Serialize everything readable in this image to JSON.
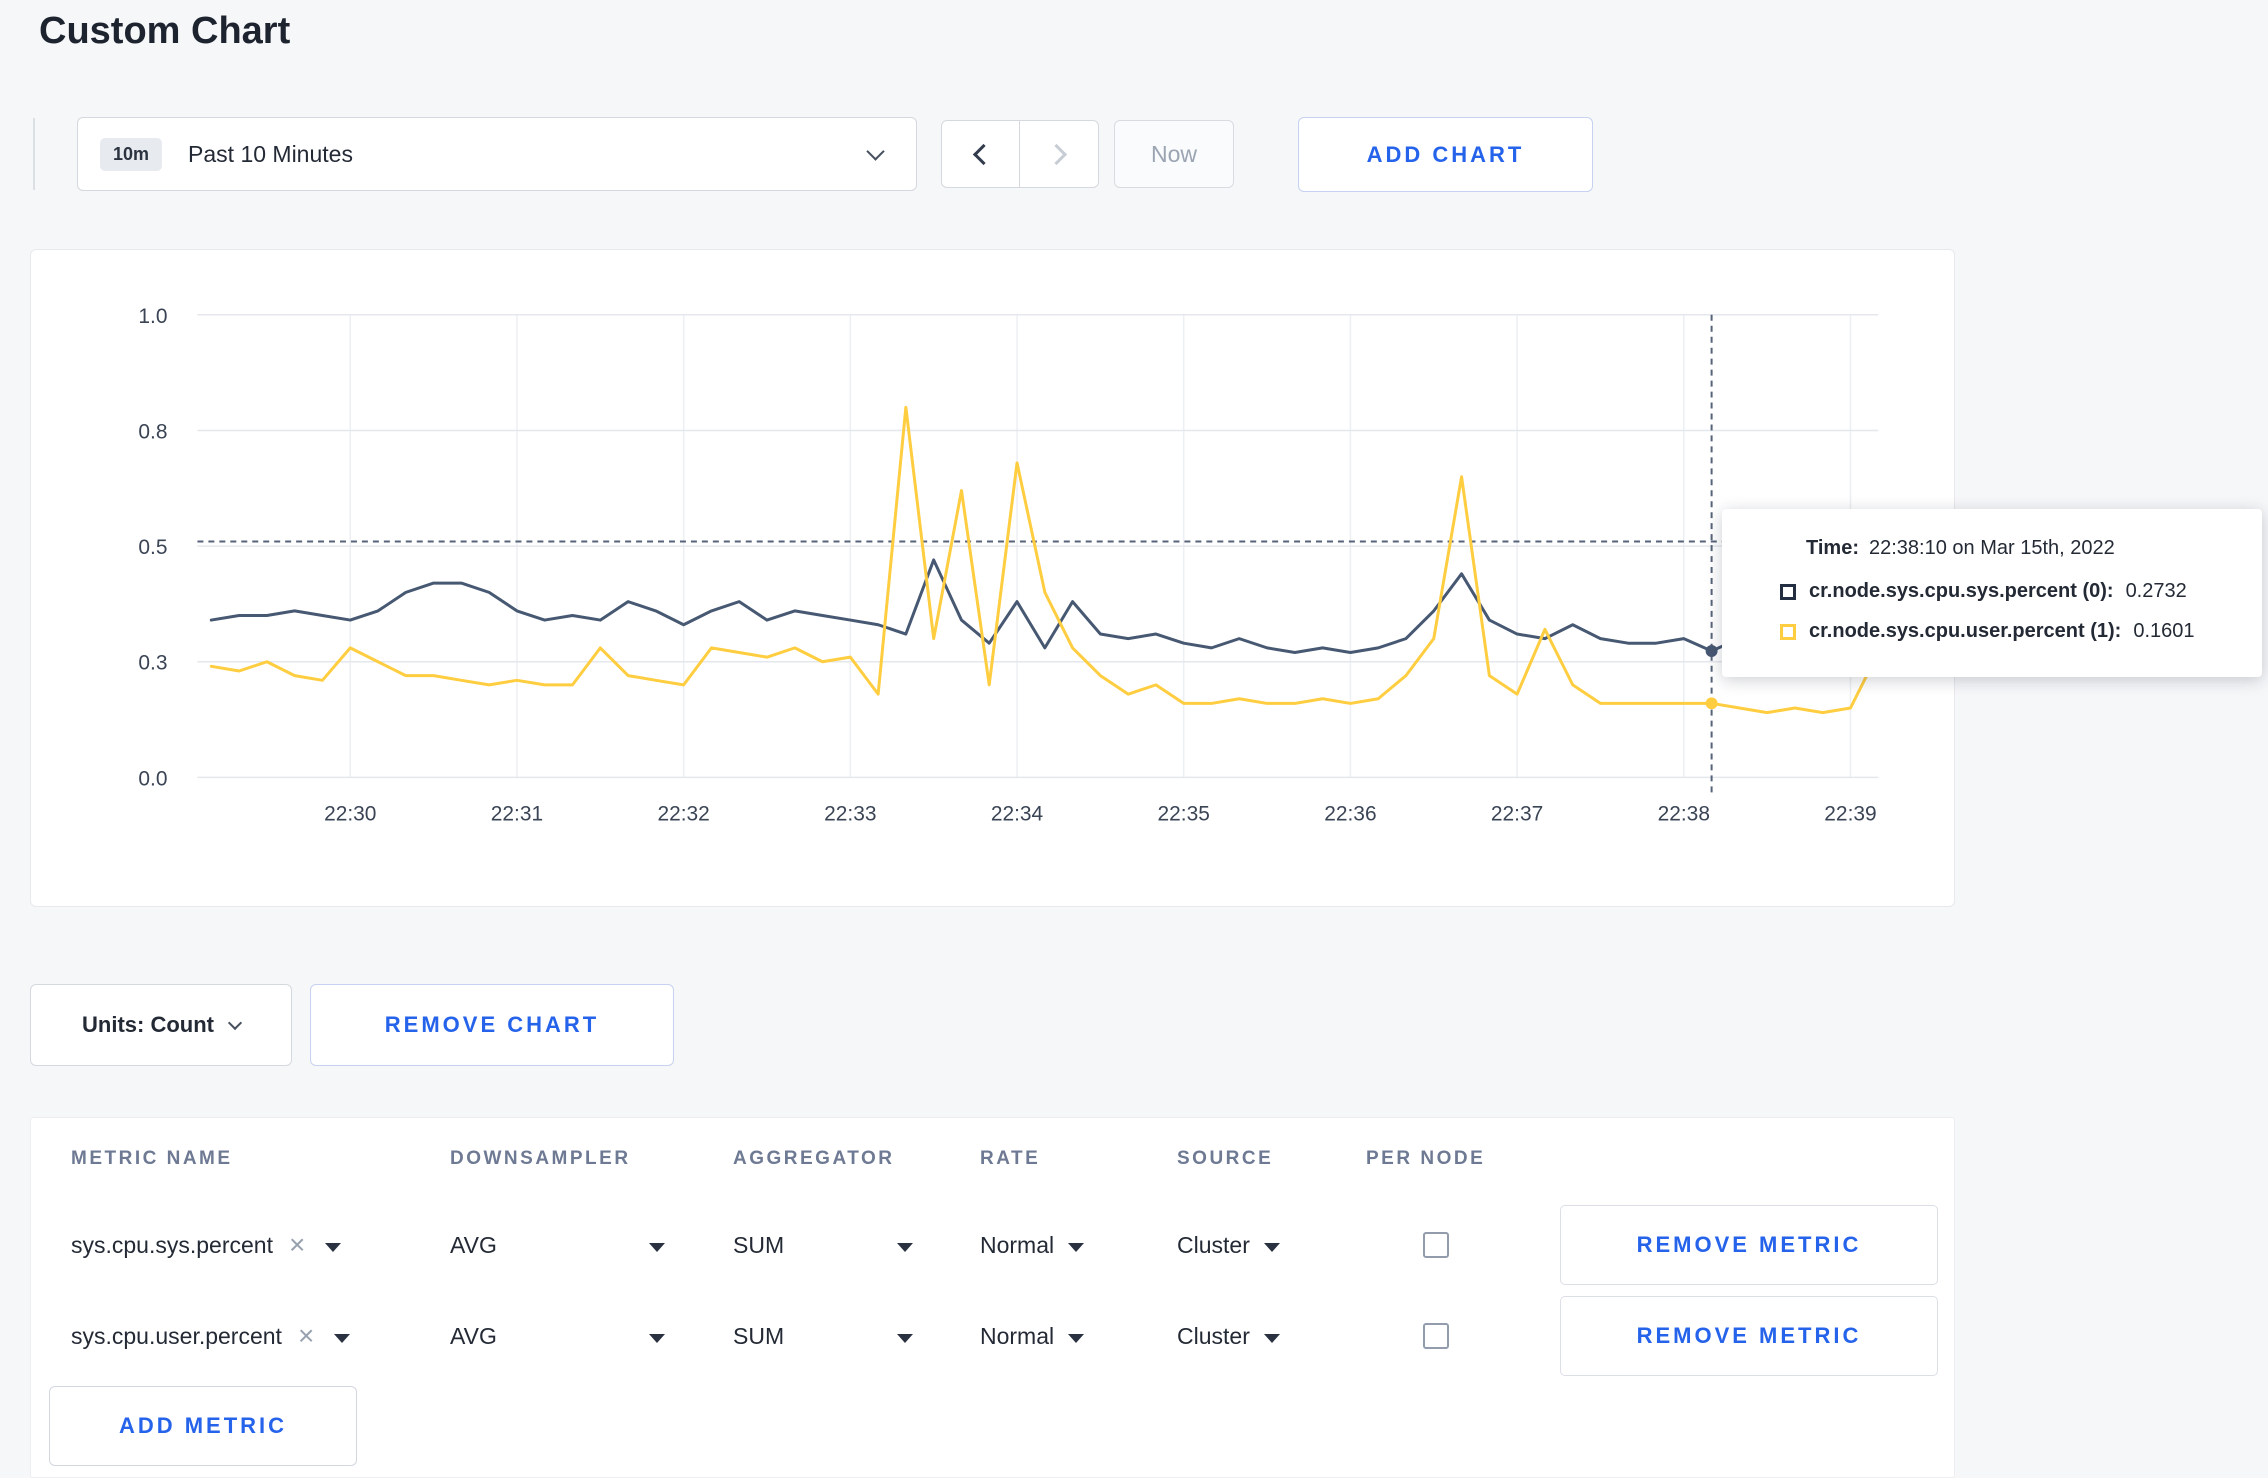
{
  "page": {
    "title": "Custom Chart",
    "background": "#f6f7f9",
    "accent": "#2563eb"
  },
  "toolbar": {
    "time_badge": "10m",
    "time_label": "Past 10 Minutes",
    "now_label": "Now",
    "add_chart_label": "ADD CHART"
  },
  "chart_data": {
    "type": "line",
    "title": "",
    "xlabel": "",
    "ylabel": "",
    "ylim": [
      0,
      1
    ],
    "grid": true,
    "x_ticks": [
      "22:30",
      "22:31",
      "22:32",
      "22:33",
      "22:34",
      "22:35",
      "22:36",
      "22:37",
      "22:38",
      "22:39"
    ],
    "y_ticks": [
      {
        "label": "0.0",
        "value": 0
      },
      {
        "label": "0.3",
        "value": 0.25
      },
      {
        "label": "0.5",
        "value": 0.5
      },
      {
        "label": "0.8",
        "value": 0.75
      },
      {
        "label": "1.0",
        "value": 1.0
      }
    ],
    "x_domain_sec": [
      -55,
      550
    ],
    "sample_start_sec": -50,
    "sample_step_sec": 10,
    "hline": 0.51,
    "crosshair_sec": 490,
    "series": [
      {
        "name": "cr.node.sys.cpu.sys.percent",
        "color": "#475872",
        "values": [
          0.34,
          0.35,
          0.35,
          0.36,
          0.35,
          0.34,
          0.36,
          0.4,
          0.42,
          0.42,
          0.4,
          0.36,
          0.34,
          0.35,
          0.34,
          0.38,
          0.36,
          0.33,
          0.36,
          0.38,
          0.34,
          0.36,
          0.35,
          0.34,
          0.33,
          0.31,
          0.47,
          0.34,
          0.29,
          0.38,
          0.28,
          0.38,
          0.31,
          0.3,
          0.31,
          0.29,
          0.28,
          0.3,
          0.28,
          0.27,
          0.28,
          0.27,
          0.28,
          0.3,
          0.36,
          0.44,
          0.34,
          0.31,
          0.3,
          0.33,
          0.3,
          0.29,
          0.29,
          0.3,
          0.2732,
          0.3,
          0.31,
          0.3,
          0.3,
          0.3,
          0.31
        ]
      },
      {
        "name": "cr.node.sys.cpu.user.percent",
        "color": "#ffcd40",
        "values": [
          0.24,
          0.23,
          0.25,
          0.22,
          0.21,
          0.28,
          0.25,
          0.22,
          0.22,
          0.21,
          0.2,
          0.21,
          0.2,
          0.2,
          0.28,
          0.22,
          0.21,
          0.2,
          0.28,
          0.27,
          0.26,
          0.28,
          0.25,
          0.26,
          0.18,
          0.8,
          0.3,
          0.62,
          0.2,
          0.68,
          0.4,
          0.28,
          0.22,
          0.18,
          0.2,
          0.16,
          0.16,
          0.17,
          0.16,
          0.16,
          0.17,
          0.16,
          0.17,
          0.22,
          0.3,
          0.65,
          0.22,
          0.18,
          0.32,
          0.2,
          0.16,
          0.16,
          0.16,
          0.16,
          0.1601,
          0.15,
          0.14,
          0.15,
          0.14,
          0.15,
          0.27
        ]
      }
    ],
    "tooltip": {
      "time_label": "Time:",
      "time_value": "22:38:10 on Mar 15th, 2022",
      "rows": [
        {
          "name": "cr.node.sys.cpu.sys.percent (0):",
          "value": "0.2732",
          "color": "#242e42"
        },
        {
          "name": "cr.node.sys.cpu.user.percent (1):",
          "value": "0.1601",
          "color": "#ffcd40"
        }
      ]
    }
  },
  "chart_controls": {
    "units_label": "Units: Count",
    "remove_chart_label": "REMOVE CHART"
  },
  "metrics_table": {
    "headers": [
      "METRIC NAME",
      "DOWNSAMPLER",
      "AGGREGATOR",
      "RATE",
      "SOURCE",
      "PER NODE"
    ],
    "rows": [
      {
        "metric": "sys.cpu.sys.percent",
        "downsampler": "AVG",
        "aggregator": "SUM",
        "rate": "Normal",
        "source": "Cluster",
        "per_node": false,
        "remove_label": "REMOVE METRIC"
      },
      {
        "metric": "sys.cpu.user.percent",
        "downsampler": "AVG",
        "aggregator": "SUM",
        "rate": "Normal",
        "source": "Cluster",
        "per_node": false,
        "remove_label": "REMOVE METRIC"
      }
    ],
    "add_metric_label": "ADD METRIC"
  }
}
